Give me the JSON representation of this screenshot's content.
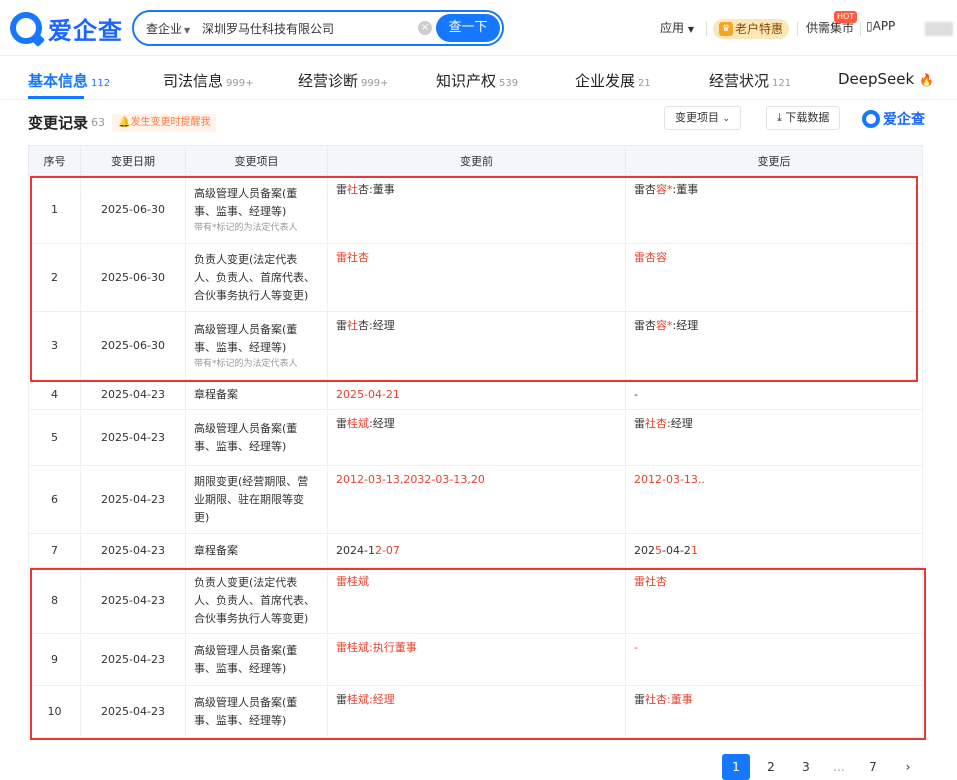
{
  "header": {
    "logo_text": "爱企查",
    "search_type": "查企业",
    "search_value": "深圳罗马仕科技有限公司",
    "search_button": "查一下",
    "nav_apps": "应用",
    "vip_label": "老户特惠",
    "market_label": "供需集市",
    "hot_badge": "HOT",
    "app_label": "APP"
  },
  "tabs": [
    {
      "label": "基本信息",
      "count": "112"
    },
    {
      "label": "司法信息",
      "count": "999+"
    },
    {
      "label": "经营诊断",
      "count": "999+"
    },
    {
      "label": "知识产权",
      "count": "539"
    },
    {
      "label": "企业发展",
      "count": "21"
    },
    {
      "label": "经营状况",
      "count": "121"
    },
    {
      "label": "DeepSeek",
      "count": ""
    }
  ],
  "section": {
    "title": "变更记录",
    "count": "63",
    "remind": "发生变更时提醒我",
    "filter_button": "变更项目",
    "download_button": "下载数据",
    "watermark": "爱企查"
  },
  "table": {
    "headers": [
      "序号",
      "变更日期",
      "变更项目",
      "变更前",
      "变更后"
    ],
    "rows": [
      {
        "no": "1",
        "date": "2025-06-30",
        "item": "高级管理人员备案(董事、监事、经理等)",
        "note": "带有*标记的为法定代表人",
        "before": [
          {
            "t": "雷"
          },
          {
            "t": "社",
            "r": true
          },
          {
            "t": "杏:董事"
          }
        ],
        "after": [
          {
            "t": "雷杏"
          },
          {
            "t": "容*",
            "r": true
          },
          {
            "t": ":董事"
          }
        ]
      },
      {
        "no": "2",
        "date": "2025-06-30",
        "item": "负责人变更(法定代表人、负责人、首席代表、合伙事务执行人等变更)",
        "note": "",
        "before": [
          {
            "t": "雷社杏",
            "r": true
          }
        ],
        "after": [
          {
            "t": "雷杏容",
            "r": true
          }
        ]
      },
      {
        "no": "3",
        "date": "2025-06-30",
        "item": "高级管理人员备案(董事、监事、经理等)",
        "note": "带有*标记的为法定代表人",
        "before": [
          {
            "t": "雷"
          },
          {
            "t": "社",
            "r": true
          },
          {
            "t": "杏:经理"
          }
        ],
        "after": [
          {
            "t": "雷杏"
          },
          {
            "t": "容*",
            "r": true
          },
          {
            "t": ":经理"
          }
        ]
      },
      {
        "no": "4",
        "date": "2025-04-23",
        "item": "章程备案",
        "note": "",
        "before": [
          {
            "t": "2025-04-21",
            "r": true
          }
        ],
        "after": [
          {
            "t": "-"
          }
        ]
      },
      {
        "no": "5",
        "date": "2025-04-23",
        "item": "高级管理人员备案(董事、监事、经理等)",
        "note": "",
        "before": [
          {
            "t": "雷"
          },
          {
            "t": "桂斌",
            "r": true
          },
          {
            "t": ":经理"
          }
        ],
        "after": [
          {
            "t": "雷"
          },
          {
            "t": "社杏",
            "r": true
          },
          {
            "t": ":经理"
          }
        ]
      },
      {
        "no": "6",
        "date": "2025-04-23",
        "item": "期限变更(经营期限、营业期限、驻在期限等变更)",
        "note": "",
        "before": [
          {
            "t": "2012-03-13,2032-03-13,20",
            "r": true
          }
        ],
        "after": [
          {
            "t": "2012-03-13..",
            "r": true
          }
        ]
      },
      {
        "no": "7",
        "date": "2025-04-23",
        "item": "章程备案",
        "note": "",
        "before": [
          {
            "t": "2024-1"
          },
          {
            "t": "2-07",
            "r": true
          }
        ],
        "after": [
          {
            "t": "202"
          },
          {
            "t": "5",
            "r": true
          },
          {
            "t": "-04-2"
          },
          {
            "t": "1",
            "r": true
          }
        ]
      },
      {
        "no": "8",
        "date": "2025-04-23",
        "item": "负责人变更(法定代表人、负责人、首席代表、合伙事务执行人等变更)",
        "note": "",
        "before": [
          {
            "t": "雷桂斌",
            "r": true
          }
        ],
        "after": [
          {
            "t": "雷社杏",
            "r": true
          }
        ]
      },
      {
        "no": "9",
        "date": "2025-04-23",
        "item": "高级管理人员备案(董事、监事、经理等)",
        "note": "",
        "before": [
          {
            "t": "雷桂斌:执行董事",
            "r": true
          }
        ],
        "after": [
          {
            "t": "-",
            "r": true
          }
        ]
      },
      {
        "no": "10",
        "date": "2025-04-23",
        "item": "高级管理人员备案(董事、监事、经理等)",
        "note": "",
        "before": [
          {
            "t": "雷"
          },
          {
            "t": "桂斌:经理",
            "r": true
          }
        ],
        "after": [
          {
            "t": "雷"
          },
          {
            "t": "社杏:董事",
            "r": true
          }
        ]
      }
    ]
  },
  "pagination": {
    "pages": [
      "1",
      "2",
      "3",
      "...",
      "7"
    ],
    "next": "›"
  },
  "colors": {
    "accent": "#1677ff",
    "highlight": "#e5412d",
    "annotation_box": "#e53935"
  }
}
